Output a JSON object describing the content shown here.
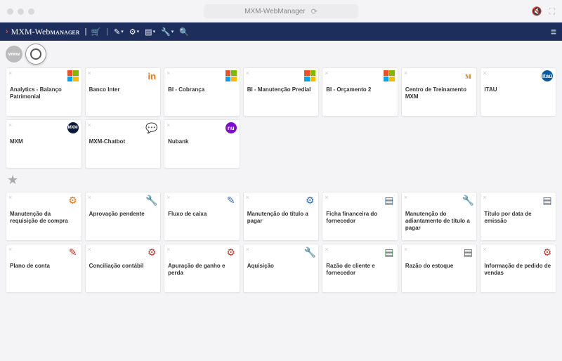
{
  "window": {
    "title": "MXM-WebManager"
  },
  "brand": "MXM-Webᴍᴀɴᴀɢᴇʀ",
  "row1": [
    {
      "label": "Analytics - Balanço Patrimonial",
      "icon": "microsoft"
    },
    {
      "label": "Banco Inter",
      "icon": "inter"
    },
    {
      "label": "BI - Cobrança",
      "icon": "microsoft"
    },
    {
      "label": "BI - Manutenção Predial",
      "icon": "microsoft"
    },
    {
      "label": "BI - Orçamento 2",
      "icon": "microsoft"
    },
    {
      "label": "Centro de Treinamento MXM",
      "icon": "moodle"
    },
    {
      "label": "ITAU",
      "icon": "itau"
    }
  ],
  "row2": [
    {
      "label": "MXM",
      "icon": "mxm"
    },
    {
      "label": "MXM-Chatbot",
      "icon": "chat"
    },
    {
      "label": "Nubank",
      "icon": "nubank"
    }
  ],
  "row3": [
    {
      "label": "Manutenção da requisição de compra",
      "icon": "gear",
      "color": "c-orange"
    },
    {
      "label": "Aprovação pendente",
      "icon": "wrench",
      "color": "c-orange"
    },
    {
      "label": "Fluxo de caixa",
      "icon": "pencil",
      "color": "c-blue"
    },
    {
      "label": "Manutenção do título a pagar",
      "icon": "gear",
      "color": "c-blue"
    },
    {
      "label": "Ficha financeira do fornecedor",
      "icon": "doc",
      "color": "c-blue"
    },
    {
      "label": "Manutenção do adiantamento de título a pagar",
      "icon": "wrench",
      "color": "c-blue"
    },
    {
      "label": "Título por data de emissão",
      "icon": "doc",
      "color": "c-blue"
    }
  ],
  "row4": [
    {
      "label": "Plano de conta",
      "icon": "pencil",
      "color": "c-red"
    },
    {
      "label": "Conciliação contábil",
      "icon": "gear",
      "color": "c-red"
    },
    {
      "label": "Apuração de ganho e perda",
      "icon": "gear",
      "color": "c-red"
    },
    {
      "label": "Aquisição",
      "icon": "wrench",
      "color": "c-red"
    },
    {
      "label": "Razão de cliente e fornecedor",
      "icon": "doc",
      "color": "c-green"
    },
    {
      "label": "Razão do estoque",
      "icon": "doc",
      "color": "c-green"
    },
    {
      "label": "Informação de pedido de vendas",
      "icon": "gear",
      "color": "c-red"
    }
  ]
}
